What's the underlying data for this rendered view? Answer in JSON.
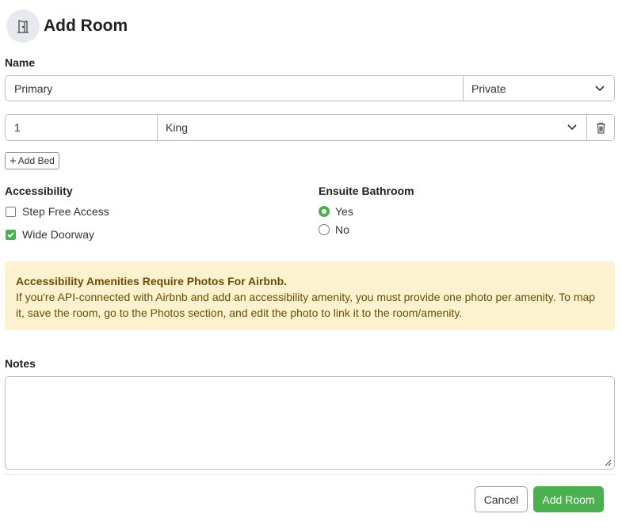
{
  "header": {
    "title": "Add Room",
    "icon": "door-icon"
  },
  "name": {
    "label": "Name",
    "value": "Primary",
    "privacy_value": "Private"
  },
  "beds": [
    {
      "count": "1",
      "type": "King"
    }
  ],
  "add_bed_label": "Add Bed",
  "accessibility": {
    "label": "Accessibility",
    "options": [
      {
        "label": "Step Free Access",
        "checked": false
      },
      {
        "label": "Wide Doorway",
        "checked": true
      }
    ]
  },
  "ensuite": {
    "label": "Ensuite Bathroom",
    "options": [
      {
        "label": "Yes",
        "selected": true
      },
      {
        "label": "No",
        "selected": false
      }
    ]
  },
  "alert": {
    "title": "Accessibility Amenities Require Photos For Airbnb.",
    "body": "If you're API-connected with Airbnb and add an accessibility amenity, you must provide one photo per amenity. To map it, save the room, go to the Photos section, and edit the photo to link it to the room/amenity."
  },
  "notes": {
    "label": "Notes",
    "value": ""
  },
  "footer": {
    "cancel_label": "Cancel",
    "submit_label": "Add Room"
  },
  "colors": {
    "accent": "#4caf50",
    "alert_bg": "#fdf2cf",
    "alert_text": "#6b4c06"
  }
}
